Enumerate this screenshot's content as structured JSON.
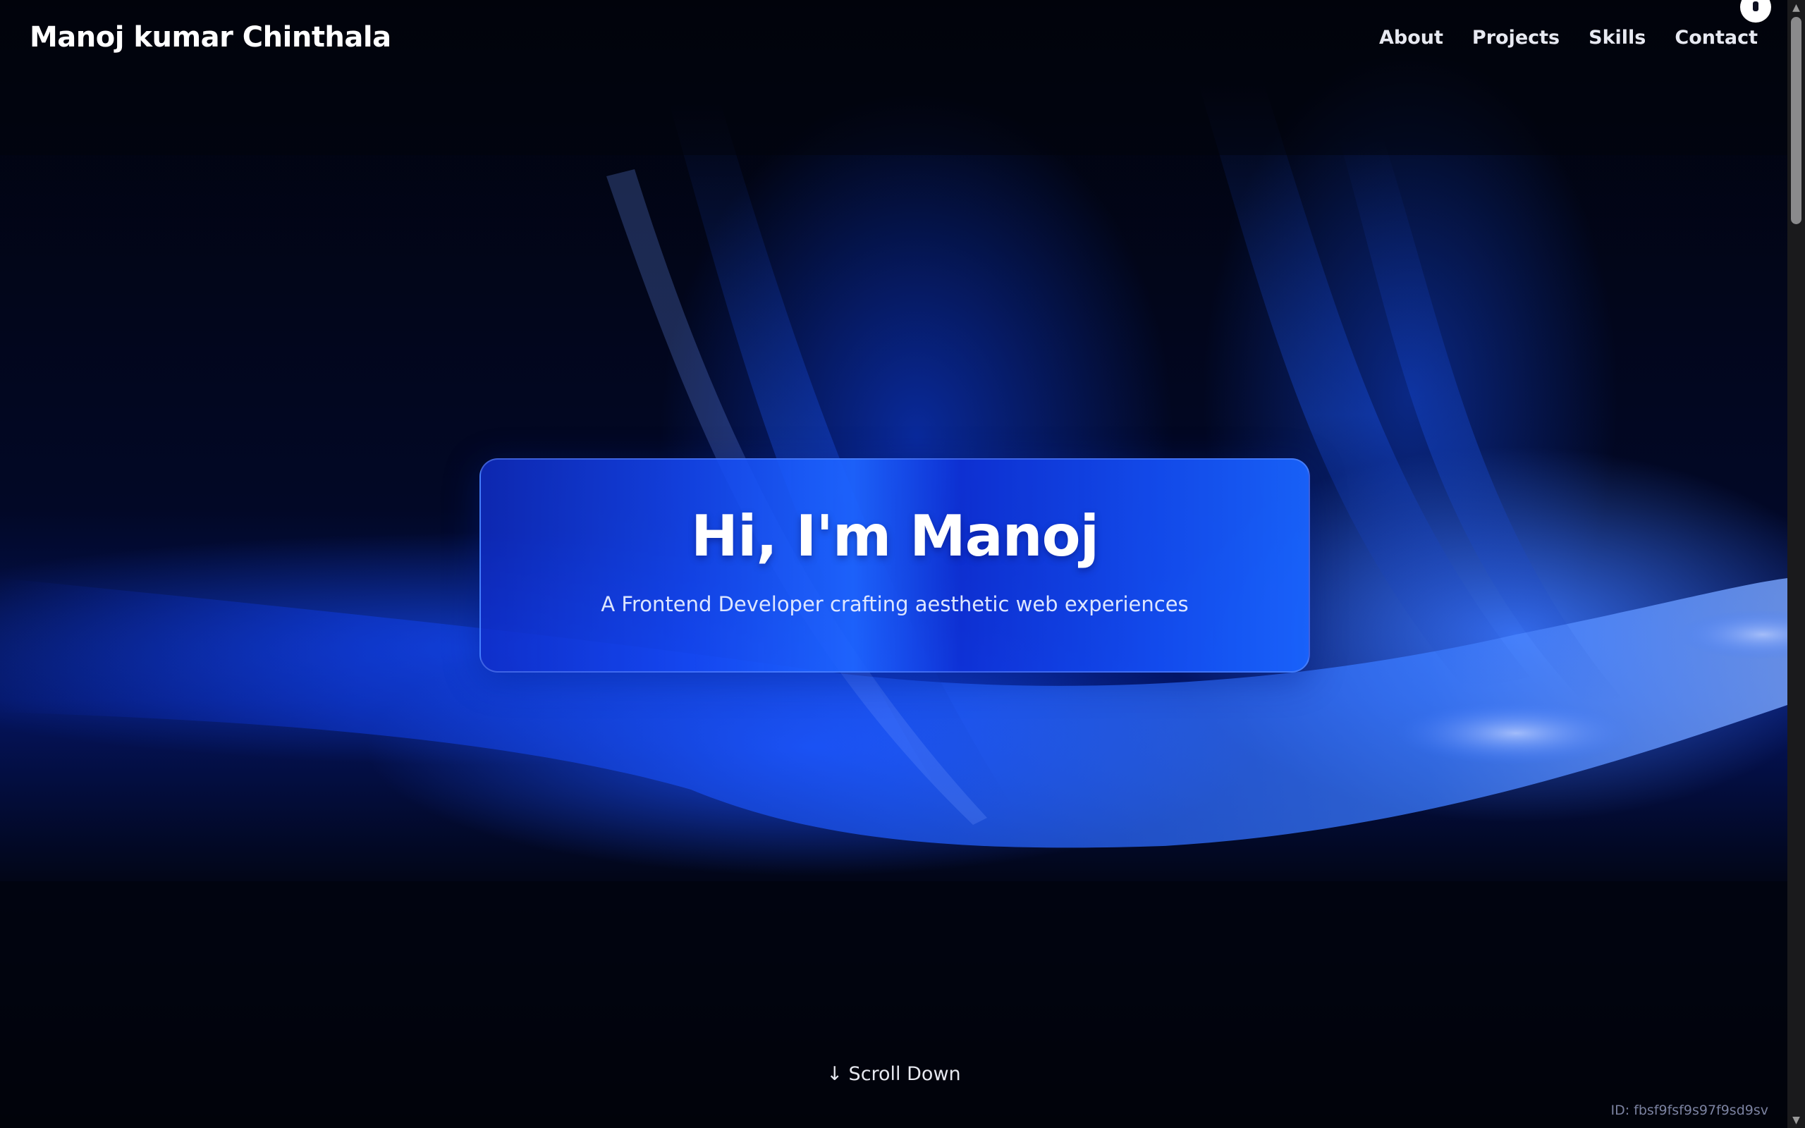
{
  "header": {
    "brand": "Manoj kumar Chinthala",
    "nav": [
      "About",
      "Projects",
      "Skills",
      "Contact"
    ]
  },
  "hero": {
    "title": "Hi, I'm Manoj",
    "subtitle": "A Frontend Developer crafting aesthetic web experiences"
  },
  "scroll_cue": "↓ Scroll Down",
  "footer_id": "ID: fbsf9fsf9s97f9sd9sv",
  "icons": {
    "theme_toggle": "theme-toggle-icon",
    "scroll_up": "scroll-up-arrow-icon",
    "scroll_down": "scroll-down-arrow-icon"
  },
  "colors": {
    "background": "#02040d",
    "accent_blue": "#1e64ff",
    "text": "#ffffff"
  }
}
